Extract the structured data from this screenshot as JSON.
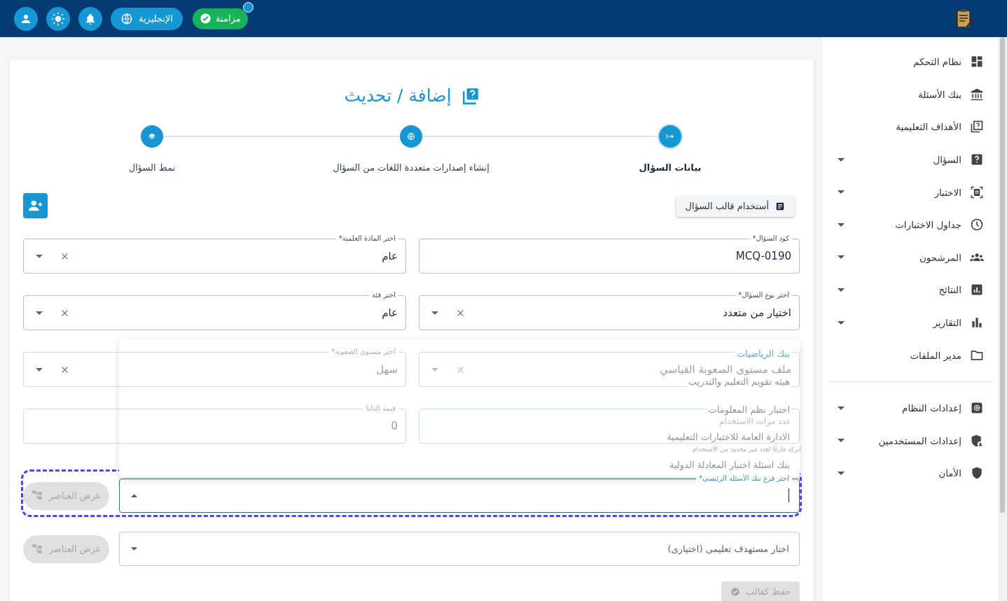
{
  "header": {
    "sync_button": "مزامنة",
    "language_button": "الإنجليزية"
  },
  "sidebar": {
    "sections": [
      {
        "items": [
          {
            "label": "نظام التحكم",
            "expandable": false
          },
          {
            "label": "بنك الأسئلة",
            "expandable": false
          },
          {
            "label": "الأهداف التعليمية",
            "expandable": false
          },
          {
            "label": "السؤال",
            "expandable": true
          },
          {
            "label": "الاختبار",
            "expandable": true
          },
          {
            "label": "جداول الاختبارات",
            "expandable": true
          },
          {
            "label": "المرشحون",
            "expandable": true
          },
          {
            "label": "النتائج",
            "expandable": true
          },
          {
            "label": "التقارير",
            "expandable": true
          },
          {
            "label": "مدير الملفات",
            "expandable": false
          }
        ]
      },
      {
        "items": [
          {
            "label": "إعدادات النظام",
            "expandable": true
          },
          {
            "label": "إعدادات المستخدمين",
            "expandable": true
          },
          {
            "label": "الأمان",
            "expandable": true
          }
        ]
      }
    ]
  },
  "page_title": "إضافة / تحديث",
  "steps": [
    {
      "label": "بيانات السؤال",
      "selected": true
    },
    {
      "label": "إنشاء إصدارات متعددة اللغات من السؤال",
      "selected": false
    },
    {
      "label": "نمط السؤال",
      "selected": false
    }
  ],
  "template_button": "أستخدام قالب السؤال",
  "fields": [
    {
      "kind": "text",
      "label": "كود السؤال*",
      "value": "MCQ-0190"
    },
    {
      "kind": "select",
      "label": "اختر المادة العلمية*",
      "value": "عام"
    },
    {
      "kind": "select",
      "label": "اختر نوع السؤال*",
      "value": "اختيار من متعدد"
    },
    {
      "kind": "select",
      "label": "اختر فئة",
      "value": "عام"
    },
    {
      "kind": "select",
      "value": "ملف مستوى الصعوبة القياسي"
    },
    {
      "kind": "select",
      "label": "اختر مستوى الصعوبة*",
      "value": "سهل"
    },
    {
      "kind": "text",
      "placeholder": "عدد مرات الاستخدام",
      "helper": "اتركه فارغًا لعدد غير محدود من الاستخدام"
    },
    {
      "kind": "text",
      "label": "قيمة الدلتا",
      "value": "0"
    }
  ],
  "menu_options": [
    "بنك الرياضيات",
    "هيئه تقويم التعليم والتدريب",
    "اختبار نظم المعلومات",
    "الادارة العامة للاختبارات التعليمية",
    "بنك اسئلة اختبار المعادلة الدولية"
  ],
  "bank_select": {
    "label": "اختر فرع بنك الأسئلة الرئيسي*",
    "expanded": true,
    "focused": true,
    "button": "عرض العناصر",
    "button_disabled": true
  },
  "target_select": {
    "placeholder": "اختار مستهدف تعليمى (اختيارى)",
    "expanded": false,
    "button": "عرض العناصر",
    "button_disabled": true
  },
  "save_button": {
    "label": "حفظ كقالب",
    "disabled": true
  }
}
